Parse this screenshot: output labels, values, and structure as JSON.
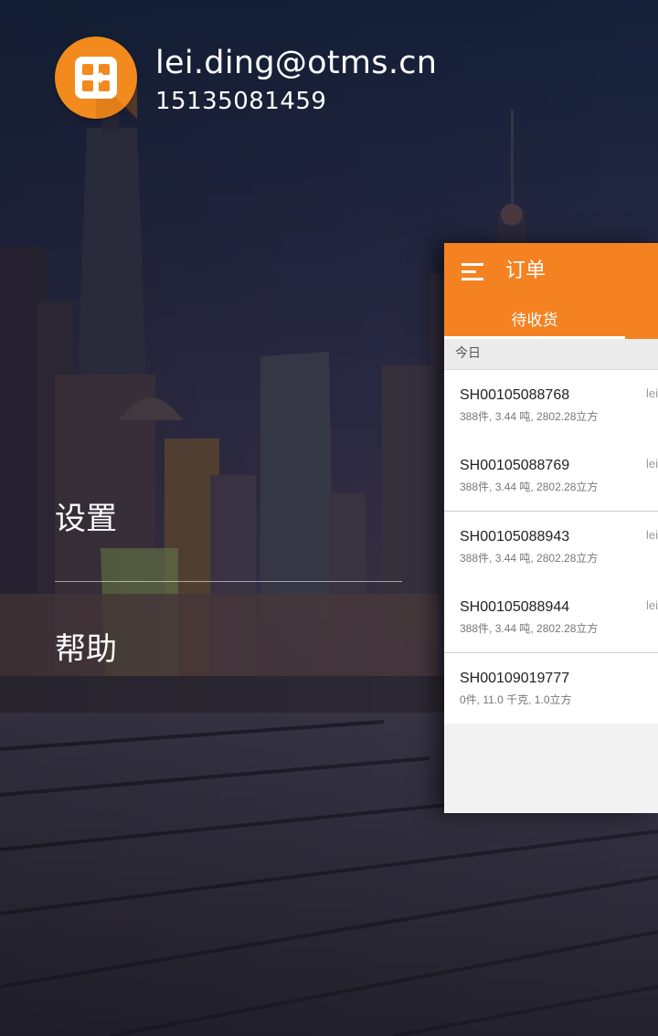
{
  "drawer": {
    "user": {
      "email": "lei.ding@otms.cn",
      "phone": "15135081459",
      "avatar_icon": "otms-logo-icon"
    },
    "menu": [
      {
        "label": "设置"
      },
      {
        "label": "帮助"
      }
    ]
  },
  "main": {
    "menu_icon": "hamburger-icon",
    "title": "订单",
    "tab": "待收货",
    "section": "今日",
    "orders": [
      {
        "order_no": "SH00105088768",
        "summary": "388件, 3.44 吨, 2802.28立方",
        "user": "lei"
      },
      {
        "order_no": "SH00105088769",
        "summary": "388件, 3.44 吨, 2802.28立方",
        "user": "lei"
      },
      {
        "order_no": "SH00105088943",
        "summary": "388件, 3.44 吨, 2802.28立方",
        "user": "lei"
      },
      {
        "order_no": "SH00105088944",
        "summary": "388件, 3.44 吨, 2802.28立方",
        "user": "lei"
      },
      {
        "order_no": "SH00109019777",
        "summary": "0件, 11.0 千克, 1.0立方",
        "user": ""
      }
    ]
  },
  "colors": {
    "accent": "#f48221",
    "avatar": "#f28a1e"
  }
}
